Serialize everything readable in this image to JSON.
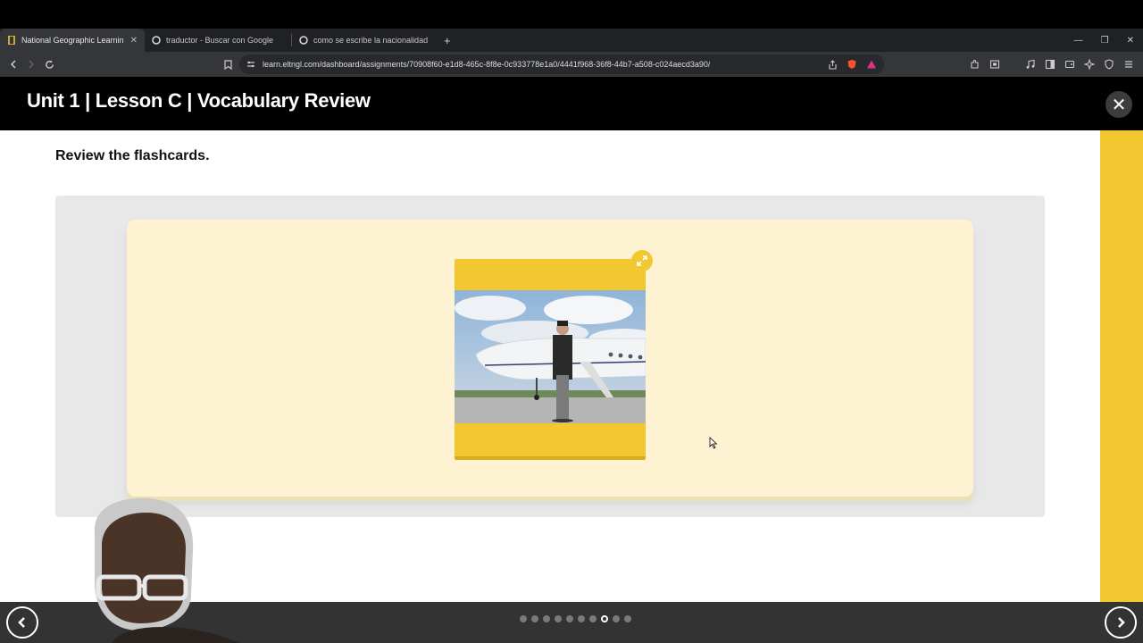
{
  "browser": {
    "tabs": [
      {
        "label": "National Geographic Learning",
        "active": true,
        "close": "✕"
      },
      {
        "label": "traductor - Buscar con Google",
        "active": false
      },
      {
        "label": "como se escribe la nacionalidad de ir",
        "active": false
      }
    ],
    "new_tab": "+",
    "url": "learn.eltngl.com/dashboard/assignments/70908f60-e1d8-465c-8f8e-0c933778e1a0/4441f968-36f8-44b7-a508-c024aecd3a90/"
  },
  "app": {
    "title": "Unit 1 | Lesson C | Vocabulary Review",
    "close_icon": "✕"
  },
  "content": {
    "instruction": "Review the flashcards.",
    "flashcard": {
      "image_alt": "man in suit standing in front of private jet",
      "expand_icon": "expand-icon"
    }
  },
  "pagination": {
    "total": 10,
    "current": 8
  },
  "colors": {
    "accent_yellow": "#f2c72f",
    "card_bg": "#fdf3d2",
    "header_bg": "#000000",
    "bottom_bar": "#333333"
  }
}
